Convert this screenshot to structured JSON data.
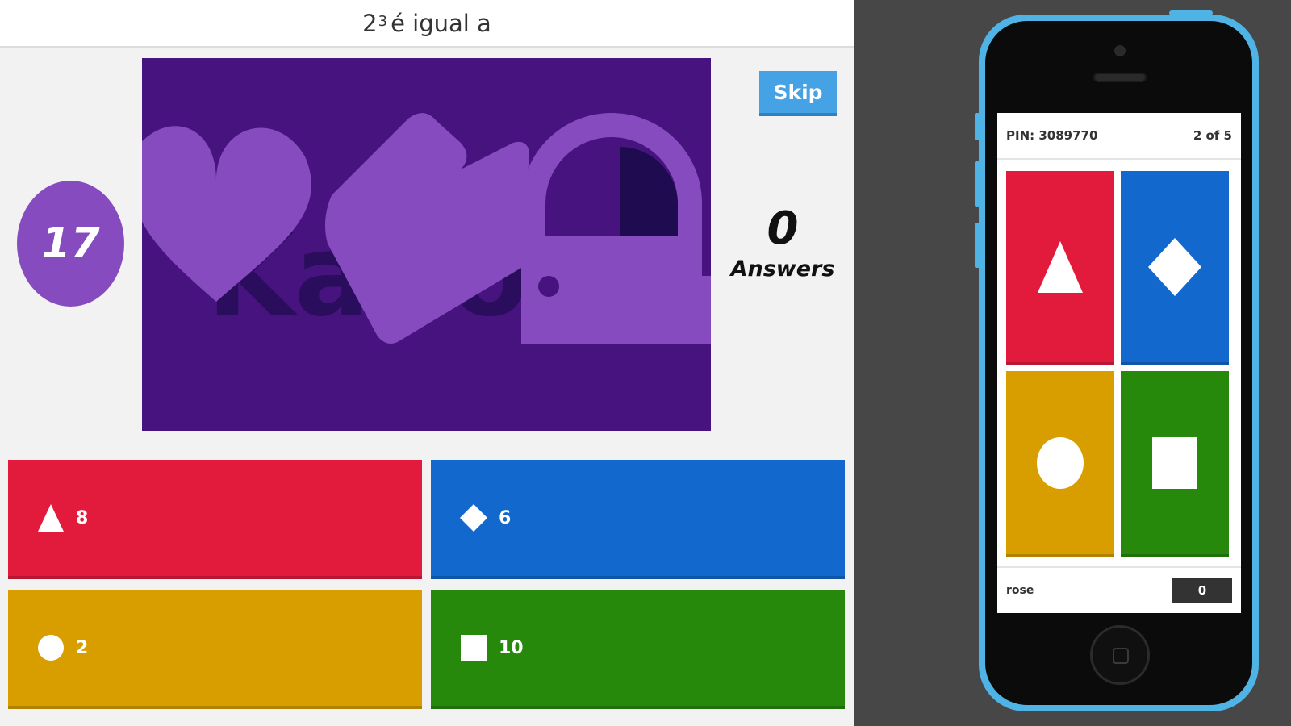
{
  "question": {
    "base": "2",
    "exponent": "3",
    "rest": "é igual a"
  },
  "timer": {
    "value": "17"
  },
  "skip": {
    "label": "Skip"
  },
  "answers_counter": {
    "count": "0",
    "label": "Answers"
  },
  "answers": [
    {
      "color": "#e21b3c",
      "icon": "triangle-icon",
      "text": "8"
    },
    {
      "color": "#1368ce",
      "icon": "diamond-icon",
      "text": "6"
    },
    {
      "color": "#d89e00",
      "icon": "circle-icon",
      "text": "2"
    },
    {
      "color": "#26890c",
      "icon": "square-icon",
      "text": "10"
    }
  ],
  "phone": {
    "pin": "PIN: 3089770",
    "progress": "2 of 5",
    "player_name": "rose",
    "score": "0",
    "tiles": [
      {
        "color": "#e21b3c",
        "icon": "triangle-icon"
      },
      {
        "color": "#1368ce",
        "icon": "diamond-icon"
      },
      {
        "color": "#d89e00",
        "icon": "circle-icon"
      },
      {
        "color": "#26890c",
        "icon": "square-icon"
      }
    ]
  },
  "colors": {
    "purple_bg": "#46137f",
    "purple_shape": "#864cbf",
    "skip_blue": "#45a3e5",
    "phone_case": "#4fb3e6",
    "right_bg": "#474747"
  }
}
